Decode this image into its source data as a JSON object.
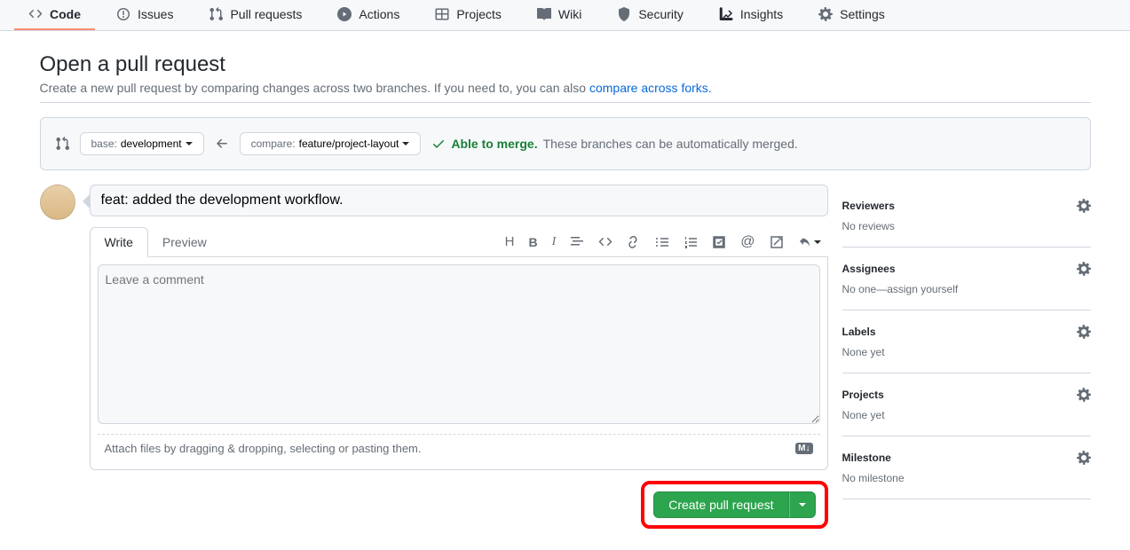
{
  "nav": {
    "code": "Code",
    "issues": "Issues",
    "pulls": "Pull requests",
    "actions": "Actions",
    "projects": "Projects",
    "wiki": "Wiki",
    "security": "Security",
    "insights": "Insights",
    "settings": "Settings"
  },
  "header": {
    "title": "Open a pull request",
    "subhead_pre": "Create a new pull request by comparing changes across two branches. If you need to, you can also ",
    "subhead_link": "compare across forks.",
    "subhead_post": ""
  },
  "range": {
    "base_label": "base:",
    "base_value": "development",
    "compare_label": "compare:",
    "compare_value": "feature/project-layout",
    "merge_ok": "Able to merge.",
    "merge_msg": "These branches can be automatically merged."
  },
  "composer": {
    "title_value": "feat: added the development workflow.",
    "tab_write": "Write",
    "tab_preview": "Preview",
    "placeholder": "Leave a comment",
    "attach_hint": "Attach files by dragging & dropping, selecting or pasting them.",
    "md_badge": "M↓",
    "create_btn": "Create pull request"
  },
  "sidebar": {
    "reviewers": {
      "title": "Reviewers",
      "sub": "No reviews"
    },
    "assignees": {
      "title": "Assignees",
      "sub": "No one—assign yourself"
    },
    "labels": {
      "title": "Labels",
      "sub": "None yet"
    },
    "projects": {
      "title": "Projects",
      "sub": "None yet"
    },
    "milestone": {
      "title": "Milestone",
      "sub": "No milestone"
    }
  }
}
